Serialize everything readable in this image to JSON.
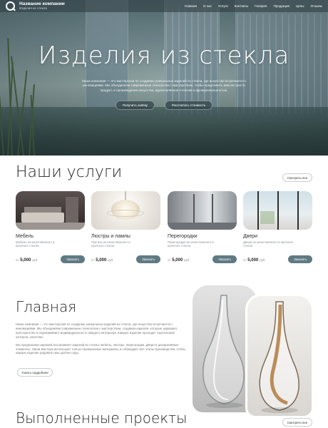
{
  "header": {
    "company_name": "Название компании",
    "company_sub": "Изделия из стекла",
    "nav": [
      "Главная",
      "О нас",
      "Услуги",
      "Контакты",
      "Галерея",
      "Продукция",
      "Цены",
      "Отзывы"
    ]
  },
  "hero": {
    "title": "Изделия из стекла",
    "description": "Наша компания — это мастерская по созданию уникальных изделий из стекла, где искусство встречается с инновациями. Мы объединяем современные технологии с мастерством, чтобы предложить вам не просто продукт, а произведение искусства, вдохновлённое стеклом и функциональностью.",
    "btn_primary": "Получить заявку",
    "btn_secondary": "Рассчитать стоимость"
  },
  "services": {
    "title": "Наши услуги",
    "see_all": "Смотреть все",
    "price_prefix": "от",
    "currency": "руб.",
    "order_label": "Заказать",
    "items": [
      {
        "name": "Мебель",
        "desc": "Мебель из качественного и прочного стекла",
        "price": "5,000",
        "photo": "furniture-photo"
      },
      {
        "name": "Люстры и лампы",
        "desc": "Люстры из качественного и прочного стекла",
        "price": "5,000",
        "photo": "chandelier-photo"
      },
      {
        "name": "Перегородки",
        "desc": "Перегородки из качественного и прочного стекла",
        "price": "5,000",
        "photo": "partition-photo"
      },
      {
        "name": "Двери",
        "desc": "Двери из качественного и прочного стекла",
        "price": "5,000",
        "photo": "door-photo"
      }
    ]
  },
  "about": {
    "title": "Главная",
    "paragraph1": "Наша компания — это мастерская по созданию уникальных изделий из стекла, где искусство встречается с инновациями. Мы объединяем современные технологии с мастерством, создавая изделия, которые украшают пространство и подчёркивают индивидуальность каждого интерьера. Каждое изделие проходит тщательный контроль качества.",
    "paragraph2": "Мы предлагаем широкий ассортимент изделий из стекла: мебель, люстры, перегородки, двери и декоративные элементы. Наши мастера используют только проверенные материалы и соблюдают все этапы производства, чтобы каждое изделие радовало вас долгие годы.",
    "more_btn": "Узнать подробнее"
  },
  "projects": {
    "title": "Выполненные проекты",
    "see_all": "Смотреть все"
  },
  "colors": {
    "accent": "#5f7a82",
    "topbar": "#324248"
  }
}
